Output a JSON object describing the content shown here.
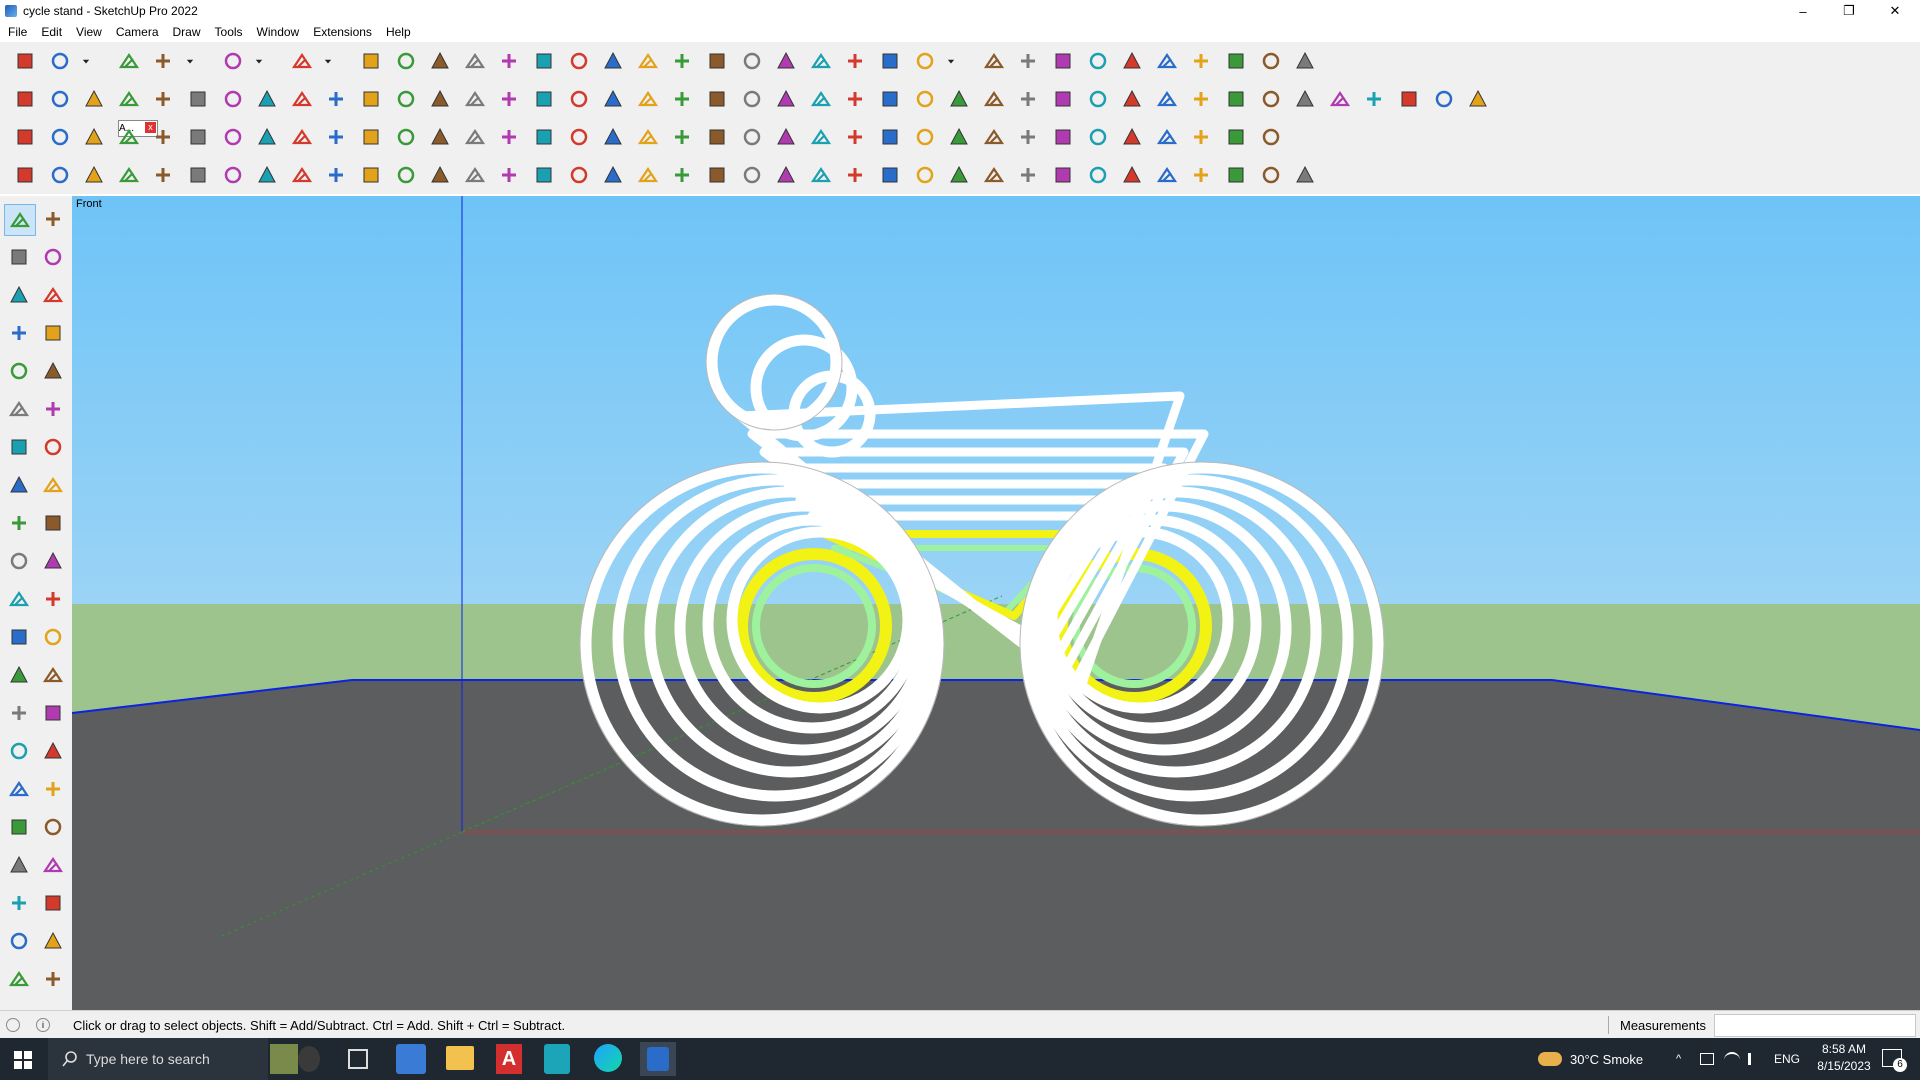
{
  "window": {
    "title": "cycle stand - SketchUp Pro 2022",
    "minimize_glyph": "–",
    "restore_glyph": "❐",
    "close_glyph": "✕"
  },
  "menu": [
    "File",
    "Edit",
    "View",
    "Camera",
    "Draw",
    "Tools",
    "Window",
    "Extensions",
    "Help"
  ],
  "toolbars": {
    "row1_icons": [
      "zoom-icon",
      "select-icon",
      "dropdown-icon",
      "eraser-icon",
      "line-icon",
      "dropdown-icon",
      "arc-icon",
      "dropdown-icon",
      "rectangle-icon",
      "dropdown-icon",
      "push-pull-icon",
      "follow-me-icon",
      "move-icon",
      "rotate-icon",
      "scale-icon",
      "tape-measure-icon",
      "text-icon",
      "paint-bucket-icon",
      "orbit-icon",
      "pan-icon",
      "zoom-window-icon",
      "zoom-extents-icon",
      "model-info-icon",
      "tags-icon",
      "layers-icon",
      "outliner-icon",
      "warehouse-icon",
      "dropdown-icon",
      "section-plane-icon",
      "section-display-icon",
      "axes-icon",
      "flip-icon",
      "flip-red-icon",
      "connect-icon",
      "solid-icon",
      "undo-icon",
      "redo-icon",
      "extension-icon"
    ],
    "row2_icons": [
      "xray-icon",
      "back-edges-icon",
      "wireframe-icon",
      "push-pull-icon",
      "extrude-1-icon",
      "extrude-2-icon",
      "extrude-3-icon",
      "extrude-4-icon",
      "extrude-5-icon",
      "extrude-6-icon",
      "extrude-7-icon",
      "bend-icon",
      "wall-1-icon",
      "wall-2-icon",
      "wall-3-icon",
      "box-icon",
      "component-icon",
      "roof-1-icon",
      "house-icon",
      "roof-2-icon",
      "shed-icon",
      "tools-icon",
      "shape-icon",
      "pencil-icon",
      "rect-icon",
      "circle-icon",
      "polygon-icon",
      "ellipse-icon",
      "parallelogram-icon",
      "curve-icon",
      "spiral-icon",
      "star-icon",
      "bezier-icon",
      "loop-icon",
      "red-line-icon",
      "eraser-2-icon",
      "texture-icon",
      "grid-icon",
      "roof-icon",
      "terrain-icon",
      "sphere-icon",
      "wall-icon",
      "stair-icon"
    ],
    "row3_icons": [
      "plane-blue-icon",
      "plane-blue-2-icon",
      "plane-yellow-icon",
      "cube-red-icon",
      "arrow-red-icon",
      "spin-icon",
      "square-red-icon",
      "panel-icon",
      "frame-icon",
      "box-brown-icon",
      "joint-icon",
      "arc-tool-icon",
      "curve-red-icon",
      "plus-red-icon",
      "plus-green-icon",
      "cross-blue-icon",
      "cone-icon",
      "cone-2-icon",
      "hook-icon",
      "cross-orange-icon",
      "rotate-dot-icon",
      "cursor-blue-icon",
      "bucket-icon",
      "magnet-icon",
      "bundle-icon",
      "flip-2-icon",
      "door-icon",
      "lock-icon",
      "gem-icon",
      "compass-icon",
      "frame-2-icon",
      "window-icon",
      "grid-orange-icon",
      "grid-orange-2-icon",
      "cross-red-icon",
      "bezier-2-icon",
      "component-2-icon"
    ],
    "row4_icons": [
      "freehand-icon",
      "line-red-icon",
      "paint-red-icon",
      "selection-icon",
      "select-flat-icon",
      "sweep-icon",
      "cube-outline-icon",
      "sphere-icon",
      "curve-tool-icon",
      "corner-icon",
      "corner-2-icon",
      "line-diag-icon",
      "spline-icon",
      "box-3d-icon",
      "sail-icon",
      "columns-icon",
      "columns-2-icon",
      "roll-icon",
      "leaf-icon",
      "triangle-icon",
      "stack-icon",
      "blade-icon",
      "blade-2-icon",
      "blade-3-icon",
      "blade-4-icon",
      "bridge-icon",
      "hatch-icon",
      "chair-icon",
      "corner-3-icon",
      "pattern-icon",
      "pattern-2-icon",
      "pattern-3-icon",
      "pattern-4-icon",
      "globe-icon",
      "globe-2-icon",
      "pattern-5-icon",
      "pattern-6-icon",
      "house-outline-icon"
    ],
    "floating_panel_label": "A..."
  },
  "leftbar_icons": [
    "select-icon",
    "orbit-icon",
    "paint-bucket-icon",
    "eraser-icon",
    "component-icon",
    "pencil-icon",
    "line-icon",
    "freehand-icon",
    "rectangle-icon",
    "rotated-rect-icon",
    "circle-icon",
    "polygon-icon",
    "arc-icon",
    "pie-icon",
    "arc-2-icon",
    "arc-3-icon",
    "move-icon",
    "push-pull-icon",
    "rotate-icon",
    "follow-me-icon",
    "scale-icon",
    "offset-icon",
    "tape-measure-icon",
    "dimension-icon",
    "protractor-icon",
    "text-icon",
    "axes-icon",
    "3d-text-icon",
    "orbit-2-icon",
    "pan-icon",
    "zoom-icon",
    "zoom-window-icon",
    "zoom-extents-icon",
    "previous-view-icon",
    "position-camera-icon",
    "look-around-icon",
    "walk-icon",
    "section-icon",
    "model-info-icon",
    "tags-icon",
    "layers-icon",
    "outliner-icon"
  ],
  "viewport": {
    "scene_label": "Front",
    "colors": {
      "sky_top": "#6ec4f7",
      "ground_far": "#9ec48e",
      "ground": "#5c5d5e",
      "blue_axis": "#0a24e0",
      "red_axis": "#d03030",
      "green_axis": "#2c9a2c",
      "accent_yellow": "#f2f215",
      "accent_green": "#9ef29e",
      "frame_white": "#ffffff"
    }
  },
  "status": {
    "message": "Click or drag to select objects. Shift = Add/Subtract. Ctrl = Add. Shift + Ctrl = Subtract.",
    "measurements_label": "Measurements",
    "measurements_value": ""
  },
  "taskbar": {
    "search_placeholder": "Type here to search",
    "weather": "30°C  Smoke",
    "language": "ENG",
    "time": "8:58 AM",
    "date": "8/15/2023",
    "notification_count": "6"
  }
}
